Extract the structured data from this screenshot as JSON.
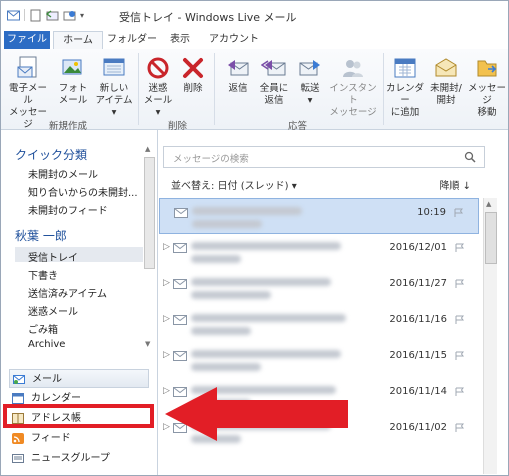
{
  "window": {
    "title": "受信トレイ - Windows Live メール"
  },
  "tabs": [
    "ファイル",
    "ホーム",
    "フォルダー",
    "表示",
    "アカウント"
  ],
  "ribbon": {
    "new_group": {
      "label": "新規作成",
      "buttons": [
        {
          "line1": "電子メール",
          "line2": "メッセージ"
        },
        {
          "line1": "フォト",
          "line2": "メール"
        },
        {
          "line1": "新しい",
          "line2": "アイテム ▾"
        }
      ]
    },
    "delete_group": {
      "label": "削除",
      "buttons": [
        {
          "line1": "迷惑",
          "line2": "メール ▾"
        },
        {
          "line1": "削除",
          "line2": ""
        }
      ]
    },
    "reply_group": {
      "label": "応答",
      "buttons": [
        {
          "line1": "返信",
          "line2": ""
        },
        {
          "line1": "全員に",
          "line2": "返信"
        },
        {
          "line1": "転送",
          "line2": "▾"
        },
        {
          "line1": "インスタント",
          "line2": "メッセージ"
        }
      ]
    },
    "other_buttons": [
      {
        "line1": "カレンダー",
        "line2": "に追加"
      },
      {
        "line1": "未開封/",
        "line2": "開封"
      },
      {
        "line1": "メッセージ",
        "line2": "移動"
      }
    ]
  },
  "sidebar": {
    "quick_heading": "クイック分類",
    "quick_items": [
      "未開封のメール",
      "知り合いからの未開封...",
      "未開封のフィード"
    ],
    "account_heading": "秋葉 一郎",
    "folders": [
      "受信トレイ",
      "下書き",
      "送信済みアイテム",
      "迷惑メール",
      "ごみ箱",
      "Archive"
    ],
    "nav": [
      "メール",
      "カレンダー",
      "アドレス帳",
      "フィード",
      "ニュースグループ"
    ]
  },
  "list": {
    "search_placeholder": "メッセージの検索",
    "sort_label": "並べ替え: 日付 (スレッド) ▾",
    "order_label": "降順 ↓",
    "messages": [
      {
        "date": "10:19",
        "selected": true
      },
      {
        "date": "2016/12/01",
        "selected": false
      },
      {
        "date": "2016/11/27",
        "selected": false
      },
      {
        "date": "2016/11/16",
        "selected": false
      },
      {
        "date": "2016/11/15",
        "selected": false
      },
      {
        "date": "2016/11/14",
        "selected": false
      },
      {
        "date": "2016/11/02",
        "selected": false
      }
    ]
  },
  "colors": {
    "file_tab": "#2c6cc4",
    "heading_blue": "#1e4f9b",
    "highlight_red": "#e21e26",
    "selected_row": "#cfe0f5"
  }
}
